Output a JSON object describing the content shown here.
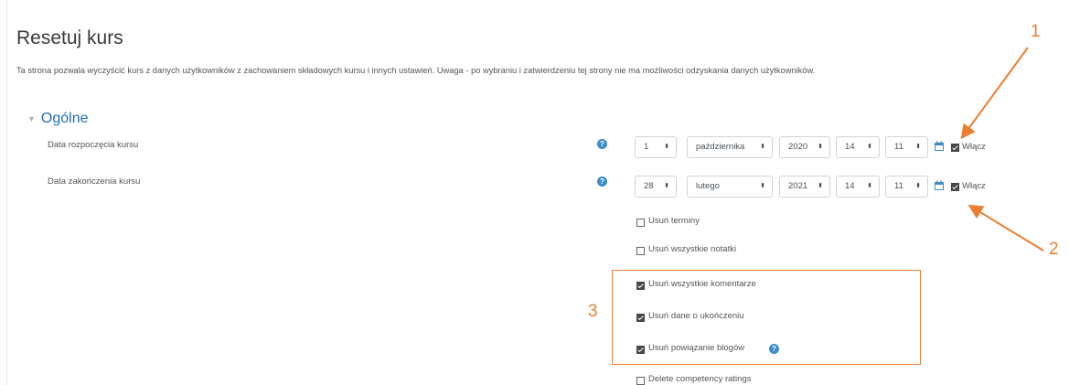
{
  "page": {
    "title": "Resetuj kurs",
    "description": "Ta strona pozwala wyczyścić kurs z danych użytkowników z zachowaniem składowych kursu i innych ustawień. Uwaga - po wybraniu i zatwierdzeniu tej strony nie ma możliwości odzyskania danych użytkowników."
  },
  "section": {
    "title": "Ogólne"
  },
  "start_date": {
    "label": "Data rozpoczęcia kursu",
    "day": "1",
    "month": "października",
    "year": "2020",
    "hour": "14",
    "minute": "11",
    "enable_label": "Włącz",
    "enabled": true
  },
  "end_date": {
    "label": "Data zakończenia kursu",
    "day": "28",
    "month": "lutego",
    "year": "2021",
    "hour": "14",
    "minute": "11",
    "enable_label": "Włącz",
    "enabled": true
  },
  "options": [
    {
      "label": "Usuń terminy",
      "checked": false
    },
    {
      "label": "Usuń wszystkie notatki",
      "checked": false
    },
    {
      "label": "Usuń wszystkie komentarze",
      "checked": true
    },
    {
      "label": "Usuń dane o ukończeniu",
      "checked": true
    },
    {
      "label": "Usuń powiązanie blogów",
      "checked": true
    },
    {
      "label": "Delete competency ratings",
      "checked": false
    }
  ],
  "annotations": {
    "one": "1",
    "two": "2",
    "three": "3"
  },
  "colors": {
    "accent": "#ed7d31",
    "link": "#1f6fb8",
    "help": "#3c8cc9"
  }
}
